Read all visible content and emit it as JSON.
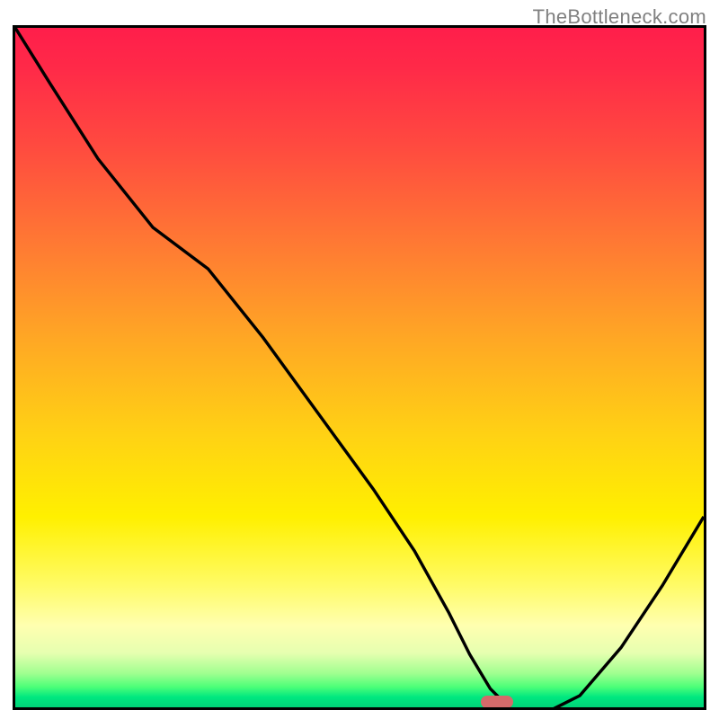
{
  "watermark": "TheBottleneck.com",
  "colors": {
    "marker": "#d46a6a",
    "curve": "#000000"
  },
  "chart_data": {
    "type": "line",
    "title": "",
    "xlabel": "",
    "ylabel": "",
    "xlim": [
      0,
      100
    ],
    "ylim": [
      0,
      100
    ],
    "x": [
      0,
      5,
      12,
      20,
      28,
      36,
      44,
      52,
      58,
      63,
      66,
      69,
      72,
      76,
      82,
      88,
      94,
      100
    ],
    "y": [
      100,
      92,
      81,
      71,
      65,
      55,
      44,
      33,
      24,
      15,
      9,
      4,
      1,
      0,
      3,
      10,
      19,
      29
    ],
    "marker": {
      "x": 70,
      "y": 0.8
    },
    "background_gradient": {
      "top": "#ff1e4b",
      "mid": "#ffd214",
      "bottom": "#00d278"
    }
  }
}
